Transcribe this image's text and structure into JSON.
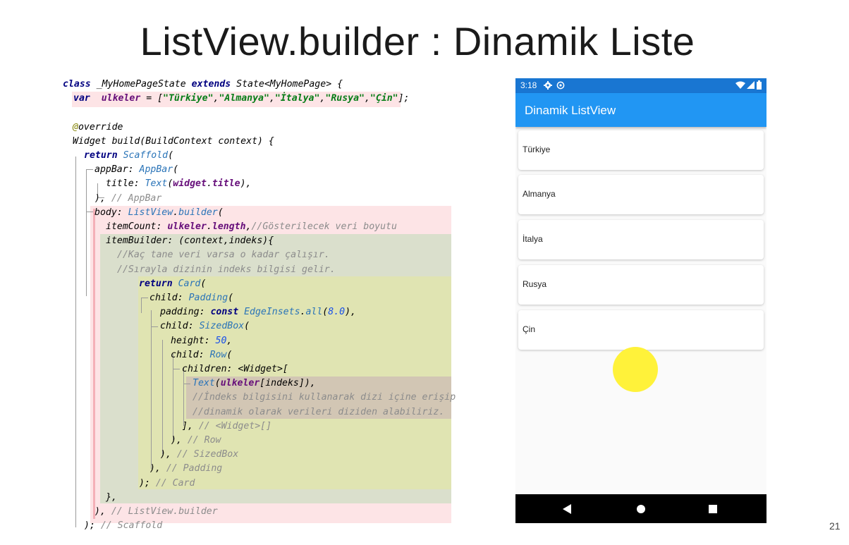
{
  "slide": {
    "title": "ListView.builder :  Dinamik Liste",
    "page_number": "21"
  },
  "code": {
    "lines": [
      [
        {
          "t": "class ",
          "c": "kw"
        },
        {
          "t": "_MyHomePageState ",
          "c": "prop"
        },
        {
          "t": "extends ",
          "c": "kw"
        },
        {
          "t": "State<MyHomePage> {",
          "c": "prop"
        }
      ],
      [
        {
          "t": "var  ",
          "c": "kw"
        },
        {
          "t": "ulkeler",
          "c": "fld"
        },
        {
          "t": " = [",
          "c": "prop"
        },
        {
          "t": "\"Türkiye\"",
          "c": "str"
        },
        {
          "t": ",",
          "c": "prop"
        },
        {
          "t": "\"Almanya\"",
          "c": "str"
        },
        {
          "t": ",",
          "c": "prop"
        },
        {
          "t": "\"İtalya\"",
          "c": "str"
        },
        {
          "t": ",",
          "c": "prop"
        },
        {
          "t": "\"Rusya\"",
          "c": "str"
        },
        {
          "t": ",",
          "c": "prop"
        },
        {
          "t": "\"Çin\"",
          "c": "str"
        },
        {
          "t": "];",
          "c": "prop"
        }
      ],
      [],
      [
        {
          "t": "@",
          "c": "ann"
        },
        {
          "t": "override",
          "c": "prop"
        }
      ],
      [
        {
          "t": "Widget build(BuildContext context) {",
          "c": "prop"
        }
      ],
      [
        {
          "t": "return ",
          "c": "kw"
        },
        {
          "t": "Scaffold",
          "c": "cls"
        },
        {
          "t": "(",
          "c": "prop"
        }
      ],
      [
        {
          "t": "appBar: ",
          "c": "prop"
        },
        {
          "t": "AppBar",
          "c": "cls"
        },
        {
          "t": "(",
          "c": "prop"
        }
      ],
      [
        {
          "t": "title: ",
          "c": "prop"
        },
        {
          "t": "Text",
          "c": "cls"
        },
        {
          "t": "(",
          "c": "prop"
        },
        {
          "t": "widget",
          "c": "fld"
        },
        {
          "t": ".",
          "c": "prop"
        },
        {
          "t": "title",
          "c": "fld"
        },
        {
          "t": "),",
          "c": "prop"
        }
      ],
      [
        {
          "t": "), ",
          "c": "prop"
        },
        {
          "t": "// AppBar",
          "c": "cmt"
        }
      ],
      [
        {
          "t": "body: ",
          "c": "prop"
        },
        {
          "t": "ListView",
          "c": "cls"
        },
        {
          "t": ".",
          "c": "prop"
        },
        {
          "t": "builder",
          "c": "cls"
        },
        {
          "t": "(",
          "c": "prop"
        }
      ],
      [
        {
          "t": "itemCount: ",
          "c": "prop"
        },
        {
          "t": "ulkeler",
          "c": "fld"
        },
        {
          "t": ".",
          "c": "prop"
        },
        {
          "t": "length",
          "c": "fld"
        },
        {
          "t": ",",
          "c": "prop"
        },
        {
          "t": "//Gösterilecek veri boyutu",
          "c": "cmt"
        }
      ],
      [
        {
          "t": "itemBuilder: (context,indeks){",
          "c": "prop"
        }
      ],
      [
        {
          "t": "//Kaç tane veri varsa o kadar çalışır.",
          "c": "cmt"
        }
      ],
      [
        {
          "t": "//Sırayla dizinin indeks bilgisi gelir.",
          "c": "cmt"
        }
      ],
      [
        {
          "t": "return ",
          "c": "kw"
        },
        {
          "t": "Card",
          "c": "cls"
        },
        {
          "t": "(",
          "c": "prop"
        }
      ],
      [
        {
          "t": "child: ",
          "c": "prop"
        },
        {
          "t": "Padding",
          "c": "cls"
        },
        {
          "t": "(",
          "c": "prop"
        }
      ],
      [
        {
          "t": "padding: ",
          "c": "prop"
        },
        {
          "t": "const ",
          "c": "kw"
        },
        {
          "t": "EdgeInsets",
          "c": "cls"
        },
        {
          "t": ".",
          "c": "prop"
        },
        {
          "t": "all",
          "c": "cls"
        },
        {
          "t": "(",
          "c": "prop"
        },
        {
          "t": "8.0",
          "c": "num"
        },
        {
          "t": "),",
          "c": "prop"
        }
      ],
      [
        {
          "t": "child: ",
          "c": "prop"
        },
        {
          "t": "SizedBox",
          "c": "cls"
        },
        {
          "t": "(",
          "c": "prop"
        }
      ],
      [
        {
          "t": "height: ",
          "c": "prop"
        },
        {
          "t": "50",
          "c": "num"
        },
        {
          "t": ",",
          "c": "prop"
        }
      ],
      [
        {
          "t": "child: ",
          "c": "prop"
        },
        {
          "t": "Row",
          "c": "cls"
        },
        {
          "t": "(",
          "c": "prop"
        }
      ],
      [
        {
          "t": "children: <Widget>[",
          "c": "prop"
        }
      ],
      [
        {
          "t": "Text",
          "c": "cls"
        },
        {
          "t": "(",
          "c": "prop"
        },
        {
          "t": "ulkeler",
          "c": "fld"
        },
        {
          "t": "[indeks]),",
          "c": "prop"
        }
      ],
      [
        {
          "t": "//İndeks bilgisini kullanarak dizi içine erişip",
          "c": "cmt"
        }
      ],
      [
        {
          "t": "//dinamik olarak verileri diziden alabiliriz.",
          "c": "cmt"
        }
      ],
      [
        {
          "t": "], ",
          "c": "prop"
        },
        {
          "t": "// <Widget>[]",
          "c": "cmt"
        }
      ],
      [
        {
          "t": "), ",
          "c": "prop"
        },
        {
          "t": "// Row",
          "c": "cmt"
        }
      ],
      [
        {
          "t": "), ",
          "c": "prop"
        },
        {
          "t": "// SizedBox",
          "c": "cmt"
        }
      ],
      [
        {
          "t": "), ",
          "c": "prop"
        },
        {
          "t": "// Padding",
          "c": "cmt"
        }
      ],
      [
        {
          "t": "); ",
          "c": "prop"
        },
        {
          "t": "// Card",
          "c": "cmt"
        }
      ],
      [
        {
          "t": "},",
          "c": "prop"
        }
      ],
      [
        {
          "t": "), ",
          "c": "prop"
        },
        {
          "t": "// ListView.builder",
          "c": "cmt"
        }
      ],
      [
        {
          "t": "); ",
          "c": "prop"
        },
        {
          "t": "// Scaffold",
          "c": "cmt"
        }
      ]
    ]
  },
  "phone": {
    "status_bar": {
      "time": "3:18",
      "left_icons": [
        "gear-icon",
        "at-sign-icon"
      ],
      "right_icons": [
        "wifi-icon",
        "signal-icon",
        "battery-icon"
      ]
    },
    "app_bar": {
      "title": "Dinamik ListView",
      "color": "#2196f3"
    },
    "list_items": [
      "Türkiye",
      "Almanya",
      "İtalya",
      "Rusya",
      "Çin"
    ],
    "nav_bar": {
      "icons": [
        "back-triangle-icon",
        "home-circle-icon",
        "recents-square-icon"
      ]
    }
  }
}
